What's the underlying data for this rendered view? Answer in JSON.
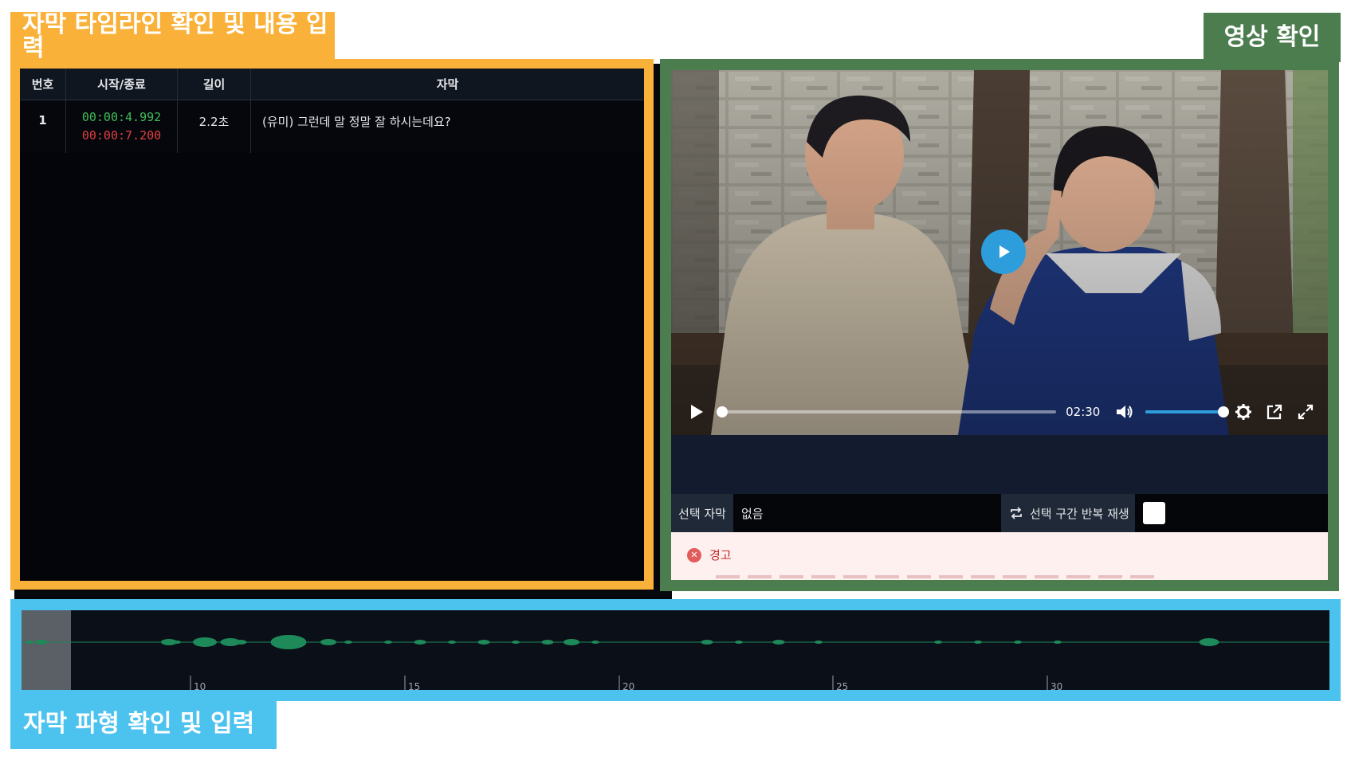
{
  "labels": {
    "subtitle_timeline": "자막 타임라인 확인 및 내용 입력",
    "video_check": "영상 확인",
    "waveform": "자막 파형 확인 및 입력"
  },
  "subtitle_table": {
    "headers": [
      "번호",
      "시작/종료",
      "길이",
      "자막"
    ],
    "rows": [
      {
        "no": "1",
        "start": "00:00:4.992",
        "end": "00:00:7.200",
        "length": "2.2초",
        "text": "(유미) 그런데 말 정말 잘 하시는데요?"
      }
    ]
  },
  "video": {
    "current_time": "02:30",
    "progress": 0.0,
    "volume": 1.0,
    "selected_label": "선택 자막",
    "selected_value": "없음",
    "repeat_label": "선택 구간 반복 재생",
    "repeat_checked": false,
    "warning_title": "경고"
  },
  "waveform": {
    "tick_labels": [
      "10",
      "15",
      "20",
      "25",
      "30"
    ]
  },
  "colors": {
    "orange": "#f9b13a",
    "green": "#4b7d4e",
    "blue": "#4cc3ef",
    "start_time": "#3fbf5a",
    "end_time": "#e04040",
    "accent": "#2e9ddb",
    "wave": "#1e8a5a"
  }
}
